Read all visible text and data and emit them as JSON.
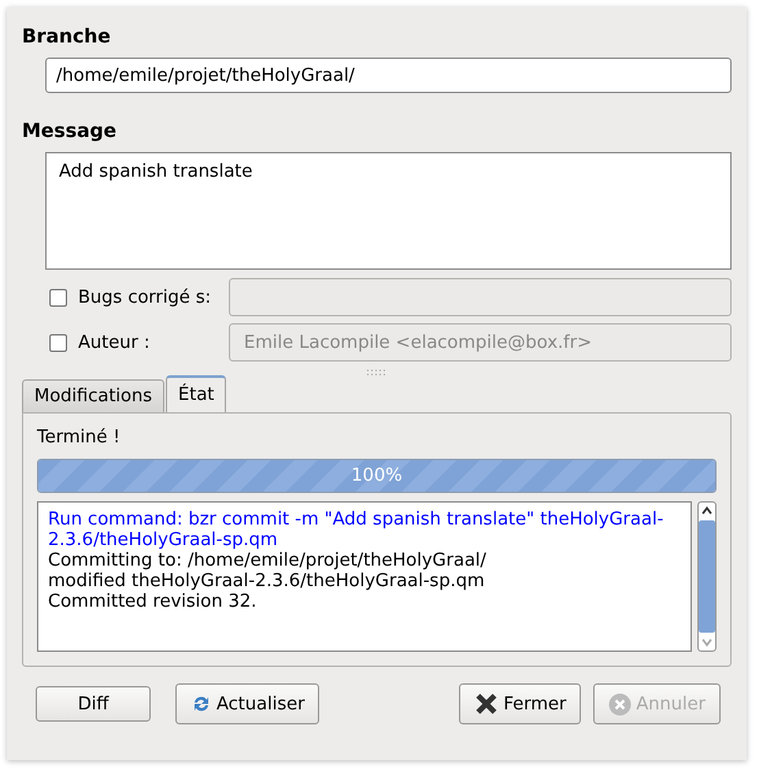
{
  "branch": {
    "label": "Branche",
    "value": "/home/emile/projet/theHolyGraal/"
  },
  "message": {
    "label": "Message",
    "value": "Add spanish translate"
  },
  "options": [
    {
      "label": "Bugs corrigé s:",
      "checked": false
    },
    {
      "label": "Auteur :",
      "checked": false,
      "placeholder": "Emile Lacompile <elacompile@box.fr>"
    }
  ],
  "tabs": [
    {
      "label": "Modifications",
      "selected": false
    },
    {
      "label": "État",
      "selected": true
    }
  ],
  "status": "Terminé !",
  "progress": {
    "level": 1,
    "reading": "100%"
  },
  "log": [
    {
      "kind": "command",
      "text": "Run command: bzr commit -m \"Add spanish translate\" theHolyGraal-2.3.6/theHolyGraal-sp.qm"
    },
    {
      "kind": "output",
      "text": "Committing to: /home/emile/projet/theHolyGraal/"
    },
    {
      "kind": "output",
      "text": "modified theHolyGraal-2.3.6/theHolyGraal-sp.qm"
    },
    {
      "kind": "output",
      "text": "Committed revision 32."
    }
  ],
  "buttons": [
    {
      "label": "Diff",
      "disabled": false
    },
    {
      "label": "Actualiser",
      "disabled": false
    },
    {
      "label": "Fermer",
      "disabled": false
    },
    {
      "label": "Annuler",
      "disabled": true
    }
  ]
}
